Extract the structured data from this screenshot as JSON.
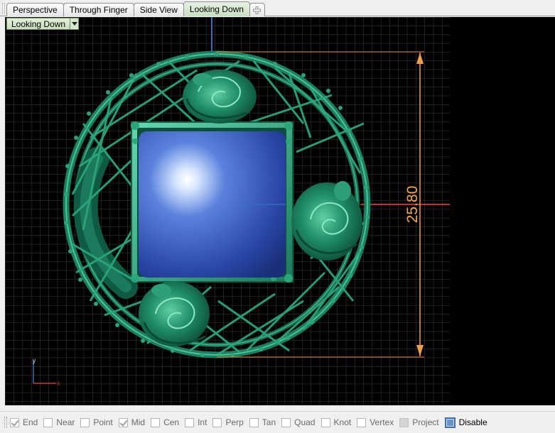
{
  "tabs": [
    {
      "label": "Perspective",
      "active": false
    },
    {
      "label": "Through Finger",
      "active": false
    },
    {
      "label": "Side View",
      "active": false
    },
    {
      "label": "Looking Down",
      "active": true
    }
  ],
  "viewport": {
    "label": "Looking Down",
    "dimension_value": "25.80",
    "background_color": "#000000",
    "grid_color": "#3a3a3a",
    "model_color": "#1f8a6a",
    "gem_color": "#3557b8",
    "dimension_color": "#f0a040",
    "axis_x_label": "x",
    "axis_y_label": "y"
  },
  "osnap": {
    "items": [
      {
        "label": "End",
        "checked": true
      },
      {
        "label": "Near",
        "checked": false
      },
      {
        "label": "Point",
        "checked": false
      },
      {
        "label": "Mid",
        "checked": true
      },
      {
        "label": "Cen",
        "checked": false
      },
      {
        "label": "Int",
        "checked": false
      },
      {
        "label": "Perp",
        "checked": false
      },
      {
        "label": "Tan",
        "checked": false
      },
      {
        "label": "Quad",
        "checked": false
      },
      {
        "label": "Knot",
        "checked": false
      },
      {
        "label": "Vertex",
        "checked": false
      },
      {
        "label": "Project",
        "checked": false
      },
      {
        "label": "Disable",
        "checked": false
      }
    ]
  }
}
